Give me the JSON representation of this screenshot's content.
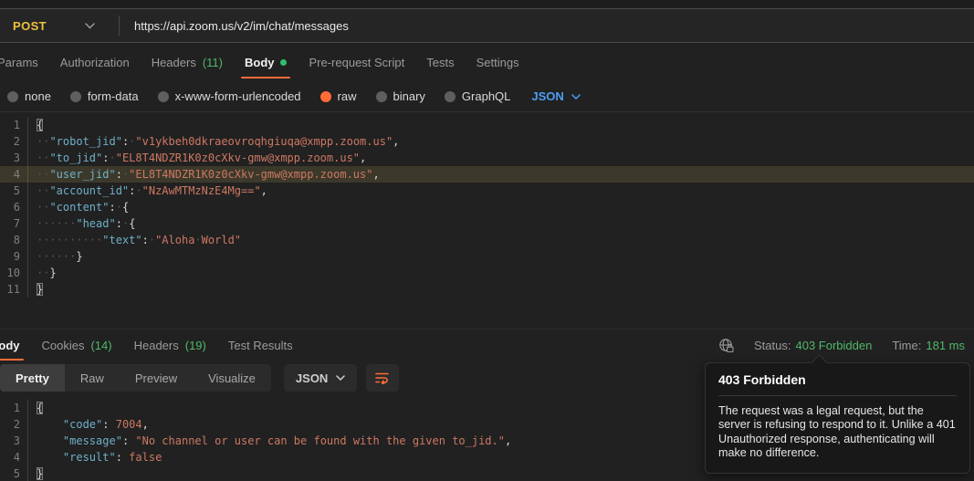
{
  "request": {
    "method": "POST",
    "url": "https://api.zoom.us/v2/im/chat/messages",
    "tabs": [
      {
        "label": "Params"
      },
      {
        "label": "Authorization"
      },
      {
        "label": "Headers",
        "count": "(11)"
      },
      {
        "label": "Body",
        "active": true,
        "dot": true
      },
      {
        "label": "Pre-request Script"
      },
      {
        "label": "Tests"
      },
      {
        "label": "Settings"
      }
    ],
    "body_types": [
      "none",
      "form-data",
      "x-www-form-urlencoded",
      "raw",
      "binary",
      "GraphQL"
    ],
    "selected_body_type": "raw",
    "language_selector": "JSON",
    "editor": {
      "show_whitespace": true,
      "highlight_line": 4,
      "lines": [
        "{",
        "  \"robot_jid\": \"v1ykbeh0dkraeovroqhgiuqa@xmpp.zoom.us\",",
        "  \"to_jid\": \"EL8T4NDZR1K0z0cXkv-gmw@xmpp.zoom.us\",",
        "  \"user_jid\": \"EL8T4NDZR1K0z0cXkv-gmw@xmpp.zoom.us\",",
        "  \"account_id\": \"NzAwMTMzNzE4Mg==\",",
        "  \"content\": {",
        "      \"head\": {",
        "          \"text\": \"Aloha World\"",
        "      }",
        "  }",
        "}"
      ]
    }
  },
  "response": {
    "tabs": [
      {
        "label": "Body",
        "active": true
      },
      {
        "label": "Cookies",
        "count": "(14)"
      },
      {
        "label": "Headers",
        "count": "(19)"
      },
      {
        "label": "Test Results"
      }
    ],
    "status_label": "Status:",
    "status_value": "403 Forbidden",
    "time_label": "Time:",
    "time_value": "181 ms",
    "view_tabs": [
      "Pretty",
      "Raw",
      "Preview",
      "Visualize"
    ],
    "active_view": "Pretty",
    "language_selector": "JSON",
    "editor": {
      "show_whitespace": false,
      "highlight_line": 0,
      "lines": [
        "{",
        "    \"code\": 7004,",
        "    \"message\": \"No channel or user can be found with the given to_jid.\",",
        "    \"result\": false",
        "}"
      ]
    }
  },
  "tooltip": {
    "title": "403 Forbidden",
    "body": "The request was a legal request, but the server is refusing to respond to it. Unlike a 401 Unauthorized response, authenticating will make no difference."
  },
  "icons": {
    "method_chevron": "chevron-down",
    "request_lang_chevron": "chevron-down",
    "response_lang_chevron": "chevron-down",
    "network": "globe-lock",
    "wrap": "text-wrap"
  },
  "colors": {
    "accent_orange": "#ff6c37",
    "method_yellow": "#eec13e",
    "status_green": "#4fb96a",
    "link_blue": "#4d9ef5",
    "json_key": "#6fb0c9",
    "json_string": "#cd7862",
    "highlight_line_bg": "#3c392b"
  }
}
